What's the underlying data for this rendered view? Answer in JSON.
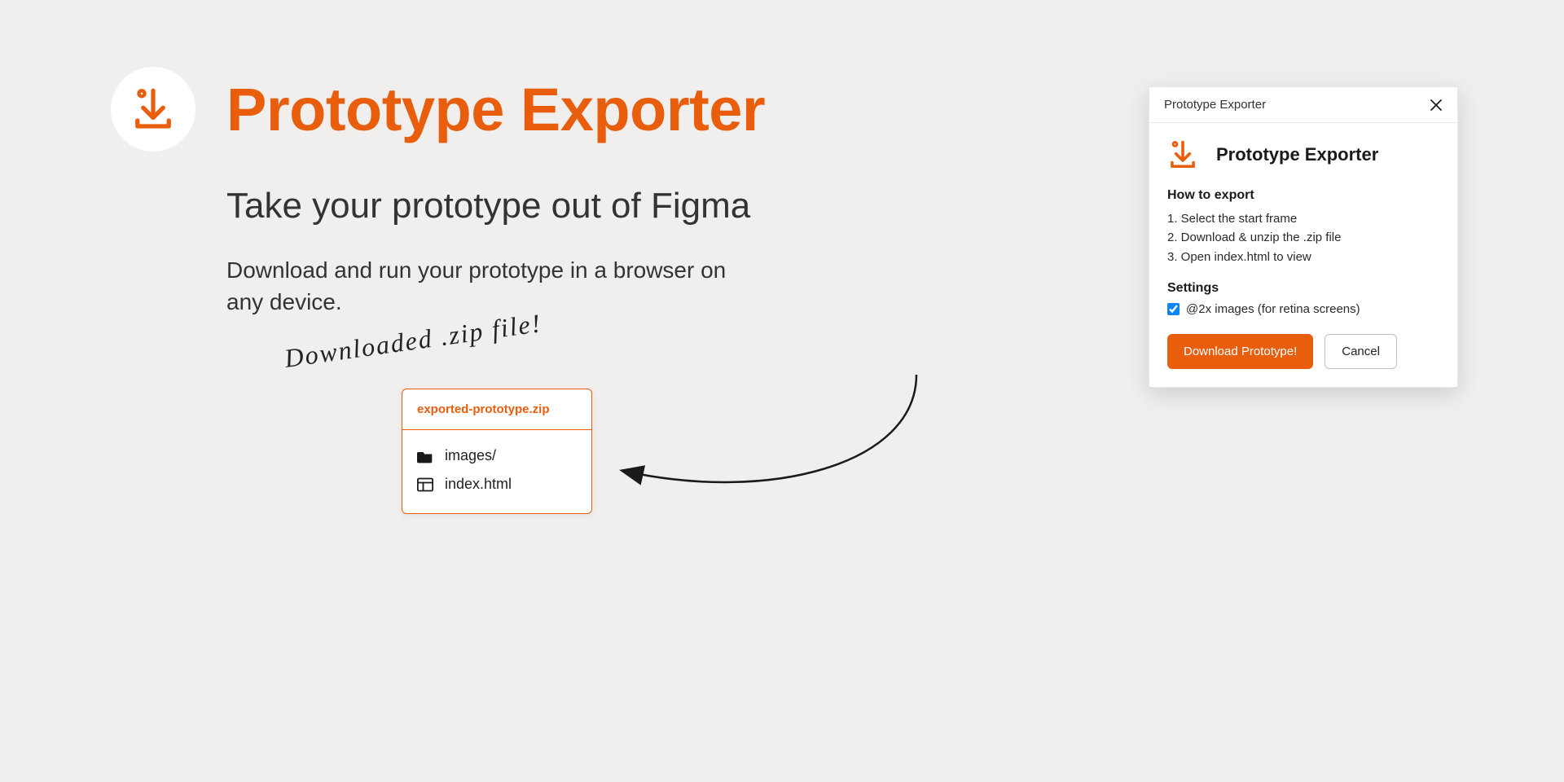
{
  "hero": {
    "title": "Prototype Exporter",
    "subtitle": "Take your prototype out of Figma",
    "body": "Download and run your prototype in a browser on any device."
  },
  "note": "Downloaded .zip file!",
  "zip": {
    "filename": "exported-prototype.zip",
    "items": [
      {
        "icon": "folder",
        "label": "images/"
      },
      {
        "icon": "html",
        "label": "index.html"
      }
    ]
  },
  "panel": {
    "window_title": "Prototype Exporter",
    "brand_title": "Prototype Exporter",
    "how_heading": "How to export",
    "steps": [
      "1. Select the start frame",
      "2. Download & unzip the .zip file",
      "3. Open index.html to view"
    ],
    "settings_heading": "Settings",
    "retina_label": "@2x images (for retina screens)",
    "retina_checked": true,
    "download_label": "Download Prototype!",
    "cancel_label": "Cancel"
  },
  "colors": {
    "accent": "#e85e0d"
  }
}
